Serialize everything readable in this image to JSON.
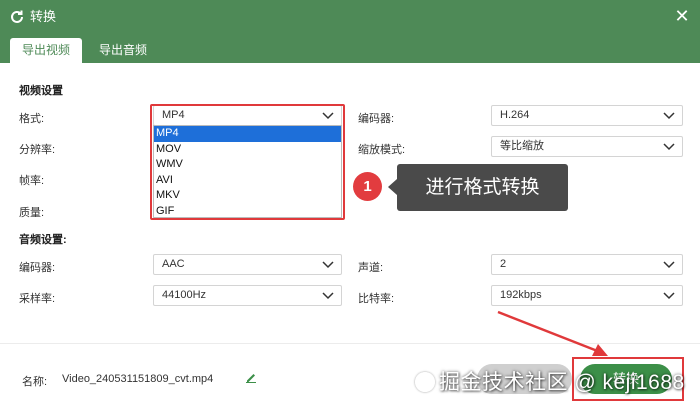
{
  "window": {
    "title": "转换",
    "close_glyph": "✕"
  },
  "tabs": [
    {
      "label": "导出视频",
      "active": true
    },
    {
      "label": "导出音频",
      "active": false
    }
  ],
  "video": {
    "section_title": "视频设置",
    "format_label": "格式:",
    "format_value": "MP4",
    "format_options": [
      "MP4",
      "MOV",
      "WMV",
      "AVI",
      "MKV",
      "GIF"
    ],
    "resolution_label": "分辨率:",
    "framerate_label": "帧率:",
    "quality_label": "质量:",
    "encoder_label": "编码器:",
    "encoder_value": "H.264",
    "scale_label": "缩放模式:",
    "scale_value": "等比缩放"
  },
  "audio": {
    "section_title": "音频设置:",
    "encoder_label": "编码器:",
    "encoder_value": "AAC",
    "samplerate_label": "采样率:",
    "samplerate_value": "44100Hz",
    "channel_label": "声道:",
    "channel_value": "2",
    "bitrate_label": "比特率:",
    "bitrate_value": "192kbps"
  },
  "annotation": {
    "badge": "1",
    "callout": "进行格式转换"
  },
  "footer": {
    "name_label": "名称:",
    "filename": "Video_240531151809_cvt.mp4",
    "cancel_label": "",
    "convert_label": "转换"
  },
  "watermark": "掘金技术社区 @ keji1688",
  "colors": {
    "titlebar": "#4e8a57",
    "accent": "#3c8f48",
    "highlight": "#e0393b",
    "selection": "#1e6fd9"
  }
}
